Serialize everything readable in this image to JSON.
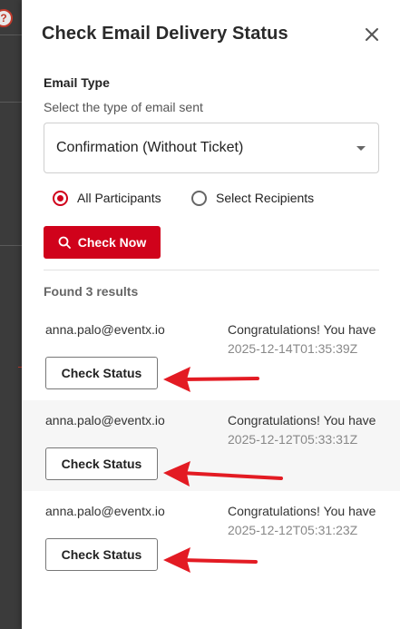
{
  "backdrop": {
    "icon": "help-circle-icon",
    "icon_glyph": "?"
  },
  "drawer": {
    "title": "Check Email Delivery Status",
    "close_icon": "close-icon"
  },
  "email_type": {
    "label": "Email Type",
    "helper": "Select the type of email sent",
    "selected": "Confirmation (Without Ticket)"
  },
  "recipients": {
    "options": [
      {
        "label": "All Participants",
        "checked": true
      },
      {
        "label": "Select Recipients",
        "checked": false
      }
    ]
  },
  "check_now": {
    "label": "Check Now",
    "icon": "search-icon"
  },
  "results": {
    "summary": "Found 3 results",
    "items": [
      {
        "email": "anna.palo@eventx.io",
        "subject": "Congratulations! You have",
        "timestamp": "2025-12-14T01:35:39Z",
        "button": "Check Status"
      },
      {
        "email": "anna.palo@eventx.io",
        "subject": "Congratulations! You have",
        "timestamp": "2025-12-12T05:33:31Z",
        "button": "Check Status"
      },
      {
        "email": "anna.palo@eventx.io",
        "subject": "Congratulations! You have",
        "timestamp": "2025-12-12T05:31:23Z",
        "button": "Check Status"
      }
    ]
  },
  "annotation": {
    "arrow_color": "#e31b23"
  },
  "colors": {
    "accent": "#d0021b",
    "row_shade": "#f6f6f6"
  }
}
